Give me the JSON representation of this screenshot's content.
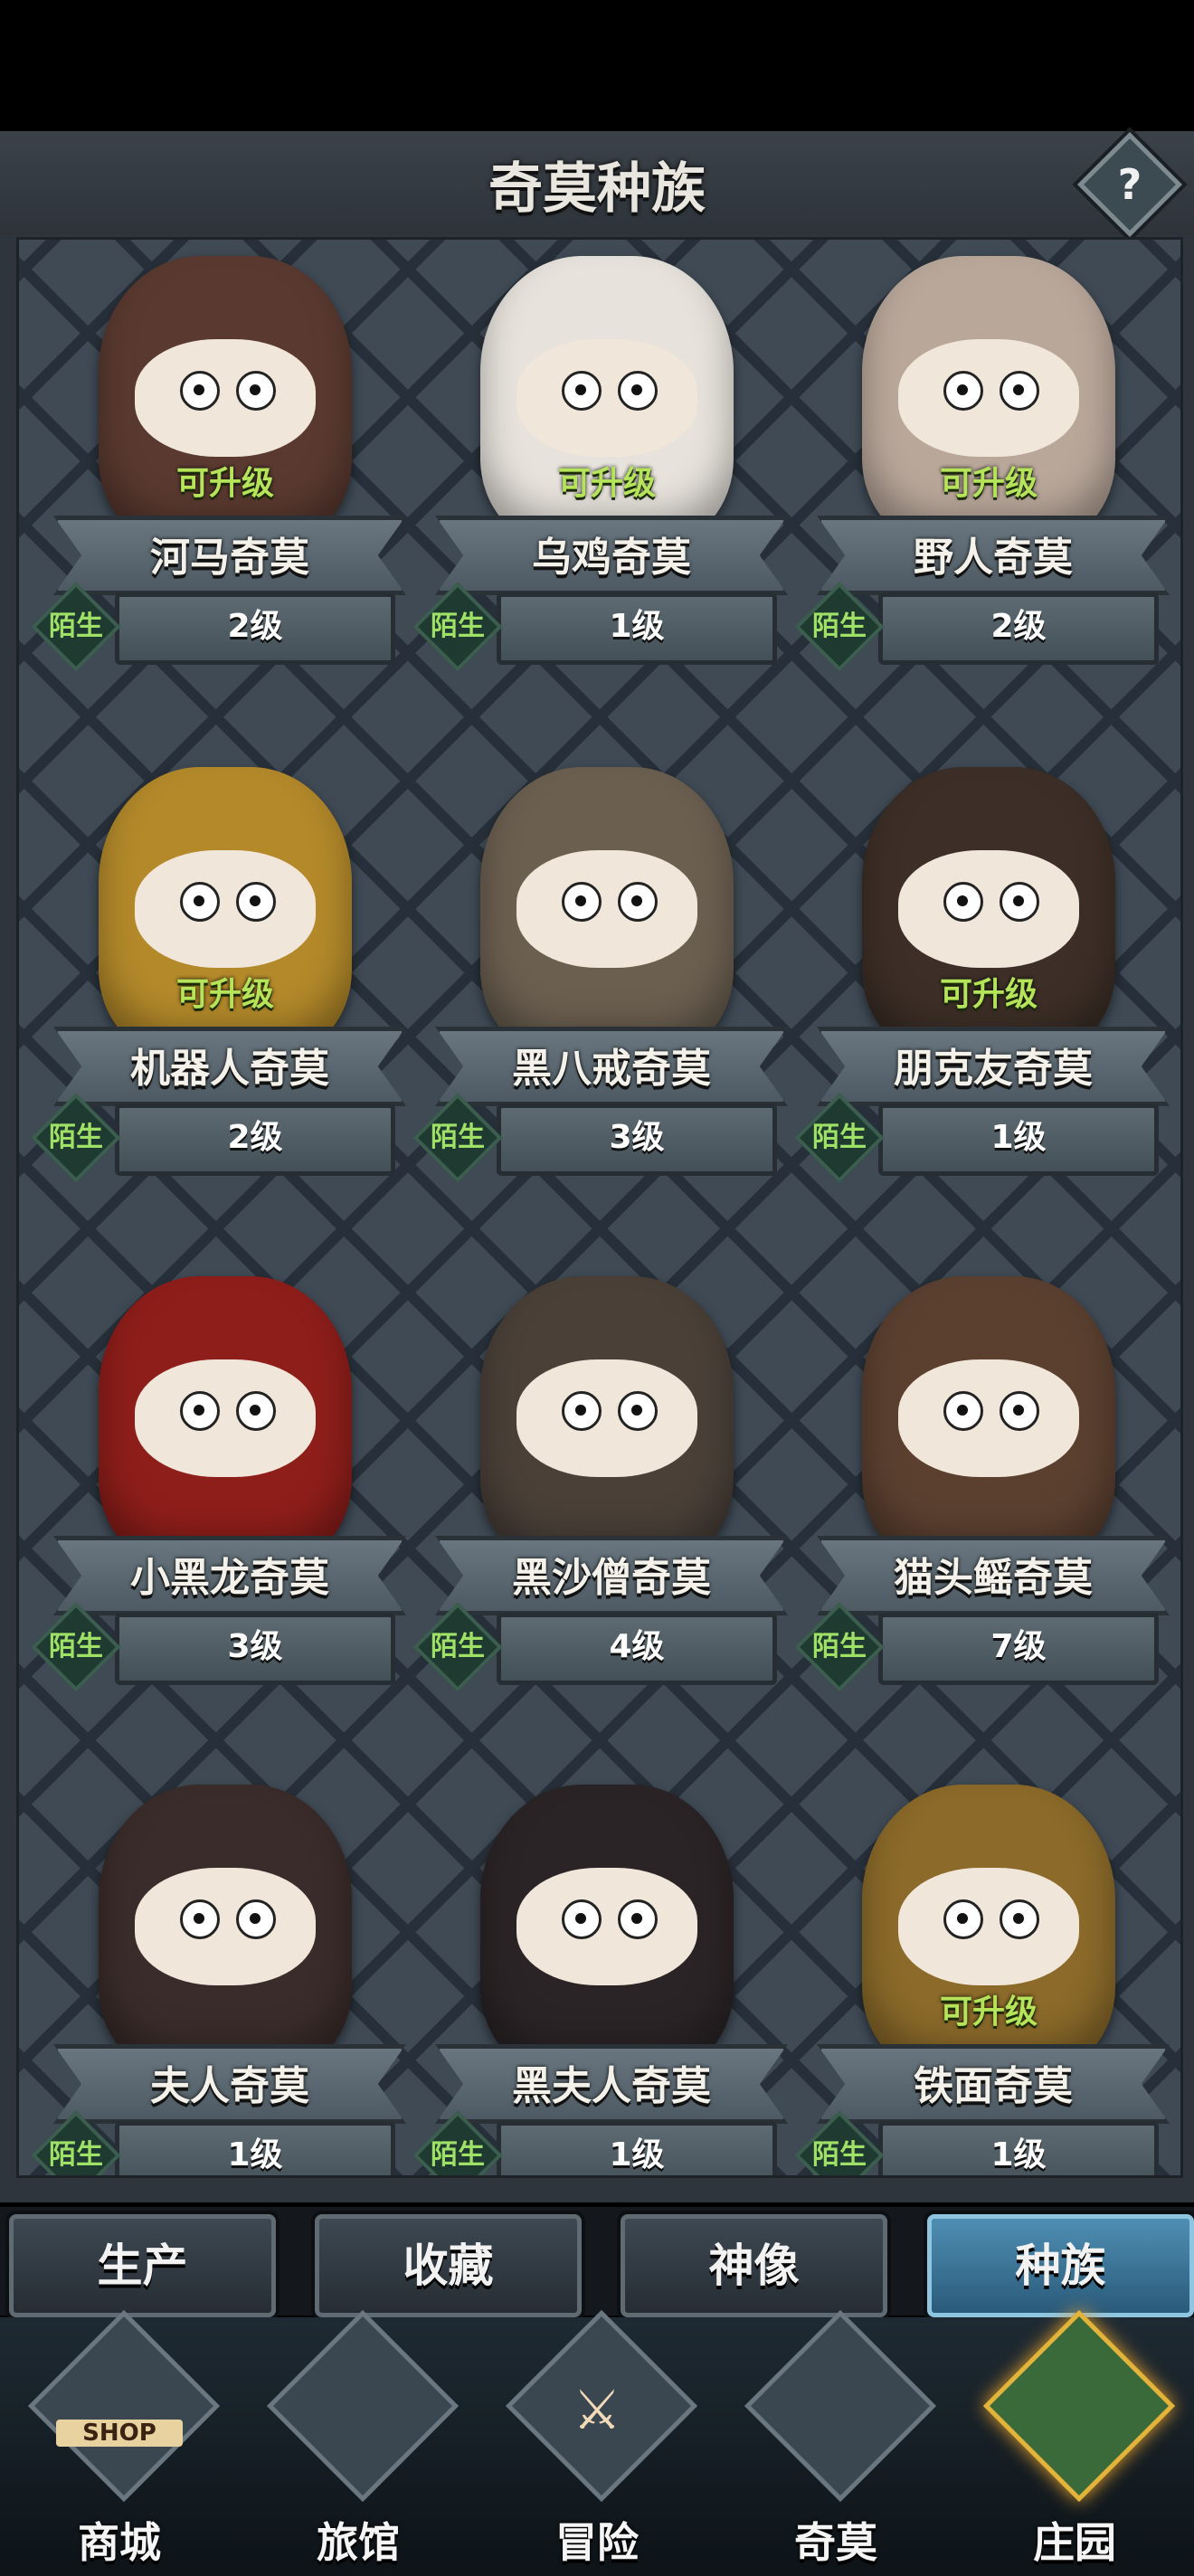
{
  "header": {
    "title": "奇莫种族",
    "help_label": "?"
  },
  "species": [
    {
      "name": "河马奇莫",
      "level": "2级",
      "status": "陌生",
      "upgrade": "可升级",
      "color": "#5a3a30"
    },
    {
      "name": "乌鸡奇莫",
      "level": "1级",
      "status": "陌生",
      "upgrade": "可升级",
      "color": "#e7e2dc"
    },
    {
      "name": "野人奇莫",
      "level": "2级",
      "status": "陌生",
      "upgrade": "可升级",
      "color": "#b9a79a"
    },
    {
      "name": "机器人奇莫",
      "level": "2级",
      "status": "陌生",
      "upgrade": "可升级",
      "color": "#b3892a"
    },
    {
      "name": "黑八戒奇莫",
      "level": "3级",
      "status": "陌生",
      "upgrade": "",
      "color": "#6b5f50"
    },
    {
      "name": "朋克友奇莫",
      "level": "1级",
      "status": "陌生",
      "upgrade": "可升级",
      "color": "#3d2f27"
    },
    {
      "name": "小黑龙奇莫",
      "level": "3级",
      "status": "陌生",
      "upgrade": "",
      "color": "#8e1e1a"
    },
    {
      "name": "黑沙僧奇莫",
      "level": "4级",
      "status": "陌生",
      "upgrade": "",
      "color": "#4a4038"
    },
    {
      "name": "猫头鳐奇莫",
      "level": "7级",
      "status": "陌生",
      "upgrade": "",
      "color": "#5b4030"
    },
    {
      "name": "夫人奇莫",
      "level": "1级",
      "status": "陌生",
      "upgrade": "",
      "color": "#3a2c2a"
    },
    {
      "name": "黑夫人奇莫",
      "level": "1级",
      "status": "陌生",
      "upgrade": "",
      "color": "#2b2426"
    },
    {
      "name": "铁面奇莫",
      "level": "1级",
      "status": "陌生",
      "upgrade": "可升级",
      "color": "#8b6a2a"
    }
  ],
  "tabs": [
    {
      "label": "生产"
    },
    {
      "label": "收藏"
    },
    {
      "label": "神像"
    },
    {
      "label": "种族",
      "active": true
    }
  ],
  "nav": [
    {
      "label": "商城",
      "icon": "shop-icon",
      "icon_text": "SHOP"
    },
    {
      "label": "旅馆",
      "icon": "inn-gate-icon"
    },
    {
      "label": "冒险",
      "icon": "crossed-swords-icon"
    },
    {
      "label": "奇莫",
      "icon": "chimo-character-icon"
    },
    {
      "label": "庄园",
      "icon": "manor-island-icon",
      "active": true
    }
  ]
}
